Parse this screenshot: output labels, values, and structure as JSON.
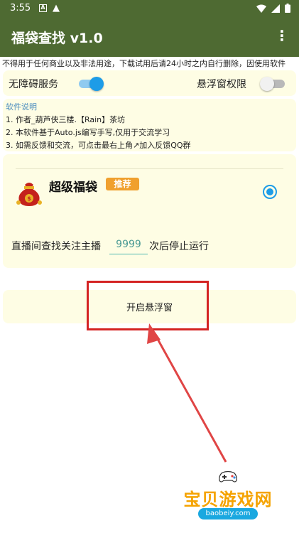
{
  "statusbar": {
    "time": "3:55",
    "icons": [
      "a-notification-icon",
      "warning-icon",
      "wifi-icon",
      "signal-icon",
      "battery-icon"
    ],
    "warn_glyph": "▲"
  },
  "appbar": {
    "title": "福袋查找 v1.0",
    "menu_glyph": "⋮"
  },
  "notice": "不得用于任何商业以及非法用途，下载试用后请24小时之内自行删除，因使用软件",
  "settings": {
    "accessibility_label": "无障碍服务",
    "accessibility_on": true,
    "float_permission_label": "悬浮窗权限",
    "float_permission_on": false
  },
  "info": {
    "heading": "软件说明",
    "lines": [
      "1. 作者_葫芦侠三楼.【Rain】茶坊",
      "2. 本软件基于Auto.js编写手写,仅用于交流学习",
      "3. 如需反馈和交流，可点击最右上角↗加入反馈QQ群"
    ]
  },
  "option": {
    "title": "超级福袋",
    "badge": "推荐",
    "selected": true,
    "count_label": "直播间查找关注主播",
    "count_value": "9999",
    "count_suffix": "次后停止运行"
  },
  "start_button_label": "开启悬浮窗",
  "watermark": {
    "text": "宝贝游戏网",
    "url": "baobeiy.com"
  },
  "colors": {
    "appbar": "#4e6a32",
    "card": "#fefde4",
    "accent_blue": "#1d9ce7",
    "badge": "#f0a02e",
    "annotation_red": "#d42323",
    "watermark": "#f5a300"
  }
}
